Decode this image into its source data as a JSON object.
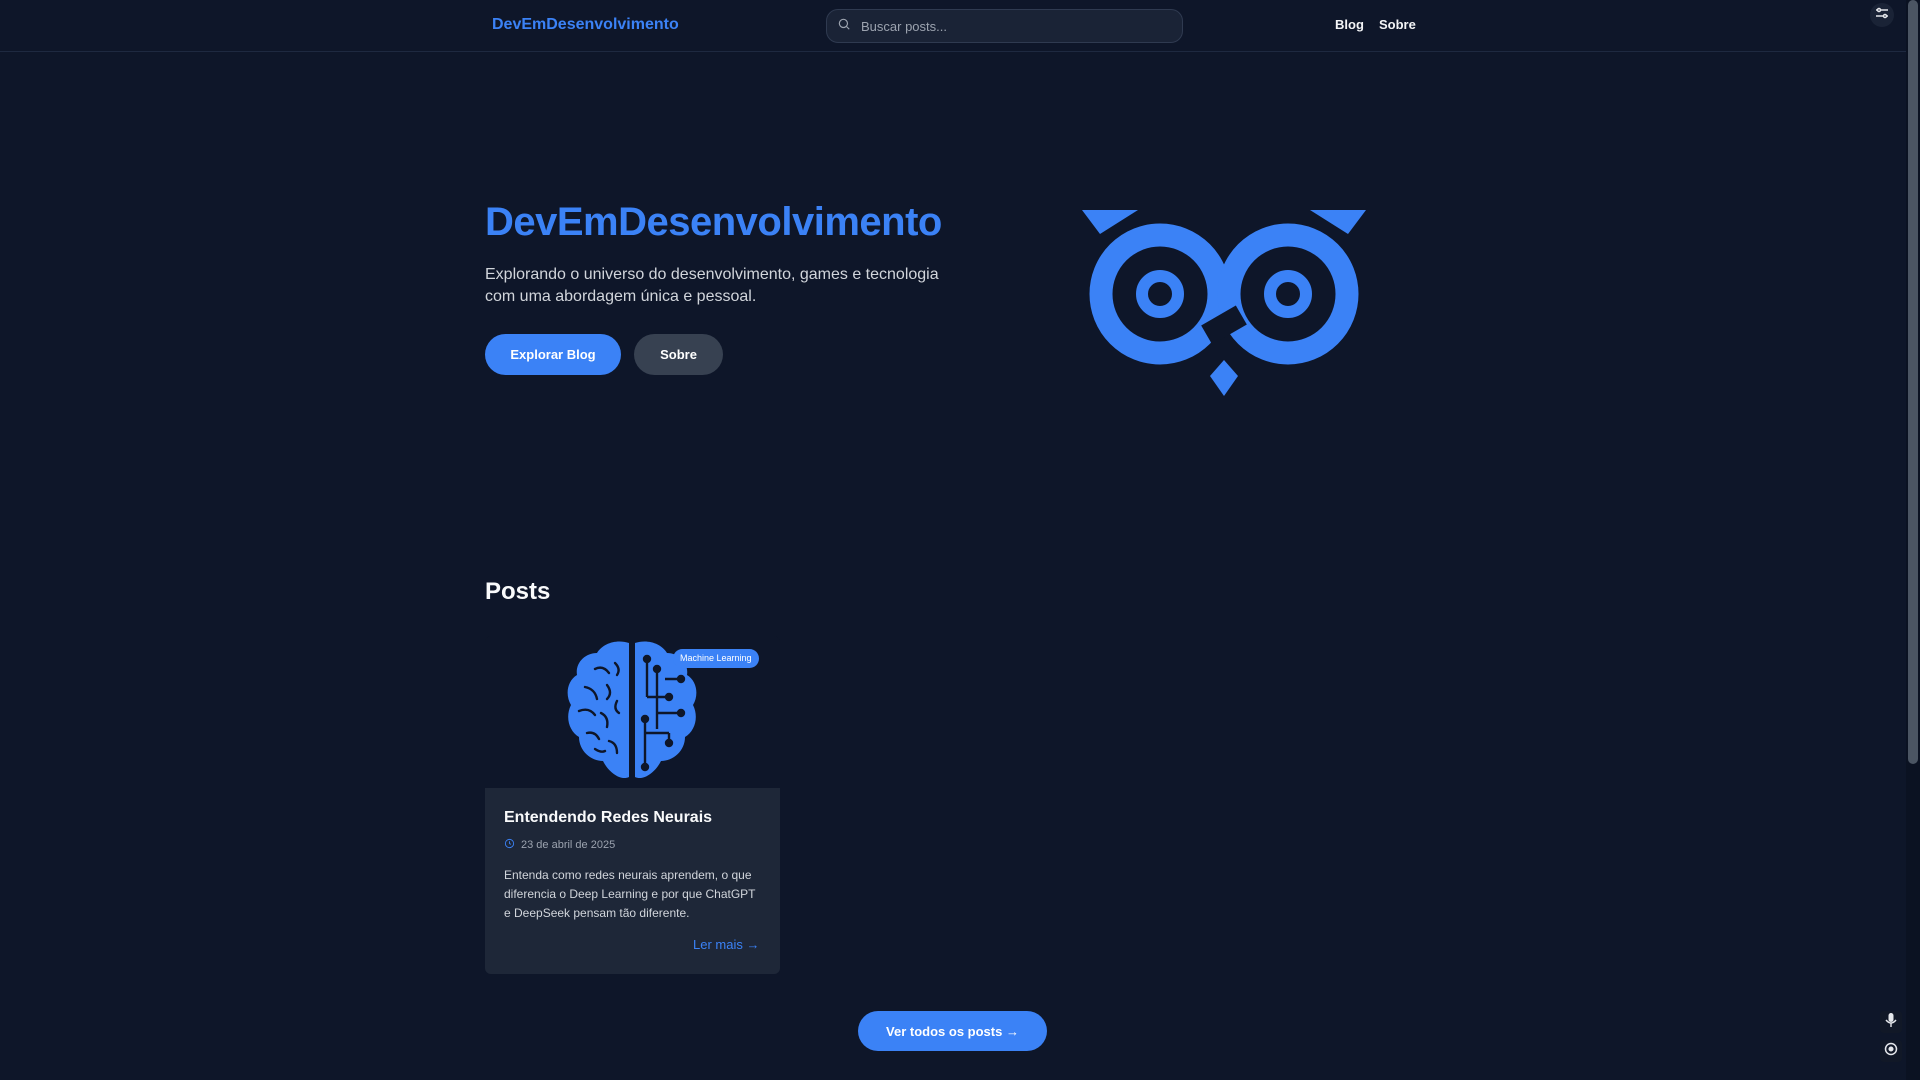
{
  "header": {
    "brand": "DevEmDesenvolvimento",
    "search_placeholder": "Buscar posts...",
    "nav": [
      "Blog",
      "Sobre"
    ]
  },
  "hero": {
    "title": "DevEmDesenvolvimento",
    "subtitle": "Explorando o universo do desenvolvimento, games e tecnologia com uma abordagem única e pessoal.",
    "primary_cta": "Explorar Blog",
    "secondary_cta": "Sobre"
  },
  "posts_section": {
    "title": "Posts",
    "posts": [
      {
        "category": "Machine Learning",
        "title": "Entendendo Redes Neurais",
        "date": "23 de abril de 2025",
        "excerpt": "Entenda como redes neurais aprendem, o que diferencia o Deep Learning e por que ChatGPT e DeepSeek pensam tão diferente.",
        "read_more": "Ler mais →"
      }
    ],
    "view_all": "Ver todos os posts →"
  },
  "icons": {
    "search": "search-icon",
    "clock": "clock-icon",
    "brain": "brain-circuit-icon",
    "owl": "owl-logo",
    "mic": "microphone-icon",
    "menu": "menu-icon"
  },
  "colors": {
    "accent": "#3b82f6",
    "background": "#0e1629",
    "card": "#1e2738"
  }
}
